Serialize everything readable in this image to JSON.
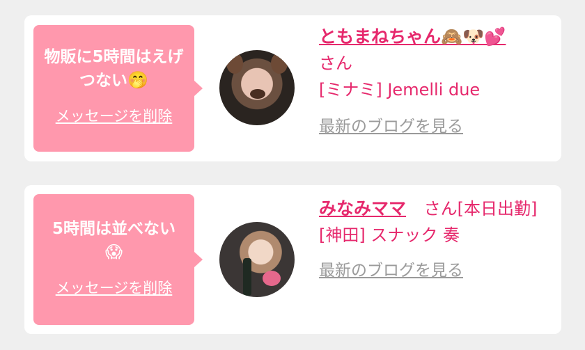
{
  "cards": [
    {
      "message": "物販に5時間はえげつない",
      "message_emoji": "🤭",
      "delete_label": "メッセージを削除",
      "name": "ともまねちゃん🙈🐶💕",
      "honorific": "さん",
      "shop": "[ミナミ] Jemelli due",
      "blog_label": "最新のブログを見る"
    },
    {
      "message": "5時間は並べない",
      "message_emoji": "😱",
      "delete_label": "メッセージを削除",
      "name": "みなみママ",
      "honorific": "さん[本日出勤]",
      "shop": "[神田] スナック 奏",
      "blog_label": "最新のブログを見る"
    }
  ]
}
